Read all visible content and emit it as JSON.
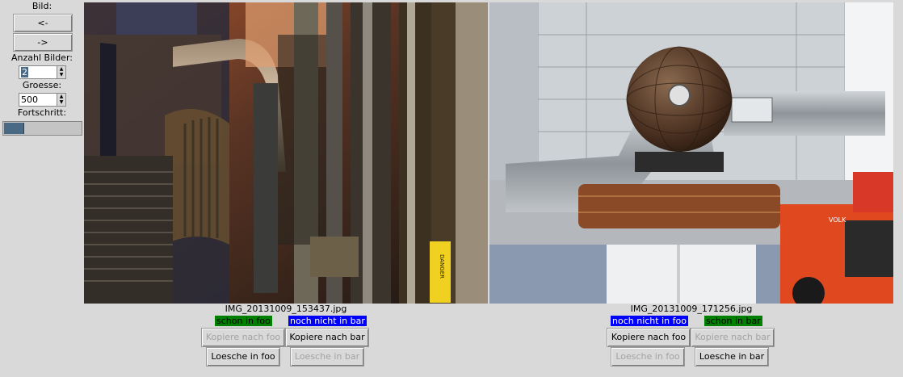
{
  "sidebar": {
    "bild_label": "Bild:",
    "prev_label": "<-",
    "next_label": "->",
    "anzahl_label": "Anzahl Bilder:",
    "anzahl_value": "2",
    "groesse_label": "Groesse:",
    "groesse_value": "500",
    "fortschritt_label": "Fortschritt:",
    "progress_fraction": 0.25
  },
  "images": [
    {
      "filename": "IMG_20131009_153437.jpg",
      "status_foo": "schon in foo",
      "status_bar": "noch nicht in bar",
      "copy_foo": "Kopiere nach foo",
      "copy_bar": "Kopiere nach bar",
      "delete_foo": "Loesche in foo",
      "delete_bar": "Loesche in bar",
      "sign_text": "DANGER"
    },
    {
      "filename": "IMG_20131009_171256.jpg",
      "status_foo": "noch nicht in foo",
      "status_bar": "schon in bar",
      "copy_foo": "Kopiere nach foo",
      "copy_bar": "Kopiere nach bar",
      "delete_foo": "Loesche in foo",
      "delete_bar": "Loesche in bar",
      "forklift_text": "VOLK"
    }
  ],
  "colors": {
    "in_status": "#008000",
    "not_in_status": "#0000ff",
    "selection": "#4a6984"
  }
}
